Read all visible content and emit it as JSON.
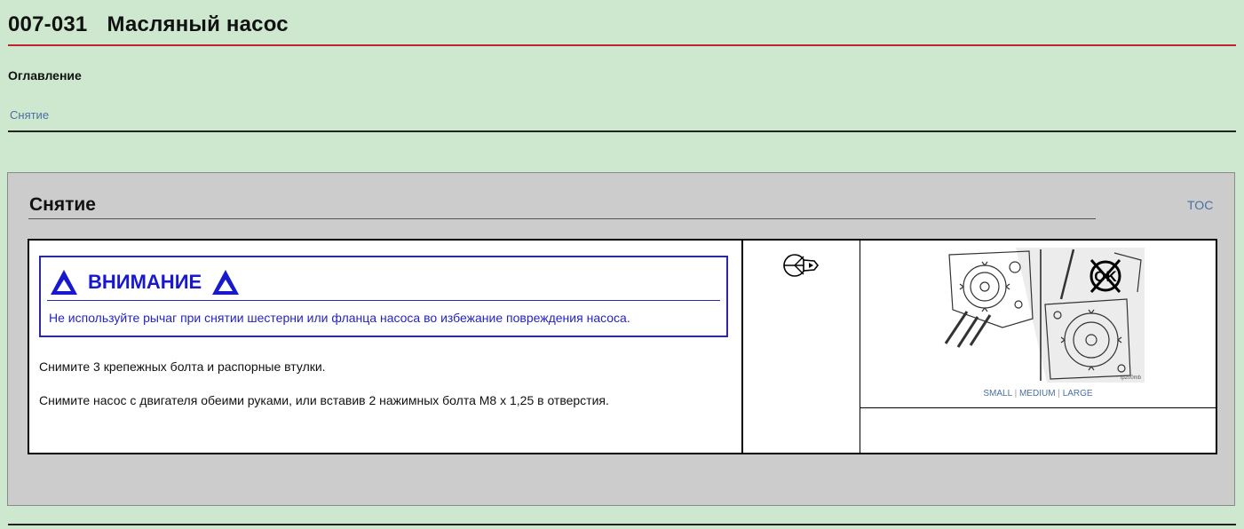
{
  "header": {
    "code": "007-031",
    "title": "Масляный насос"
  },
  "toc": {
    "heading": "Оглавление",
    "items": [
      {
        "label": "Снятие"
      }
    ]
  },
  "section": {
    "title": "Снятие",
    "toc_link": "TOC",
    "warning": {
      "label": "ВНИМАНИЕ",
      "text": "Не используйте рычаг при снятии шестерни или фланца насоса во избежание повреждения насоса."
    },
    "steps": [
      "Снимите 3 крепежных болта и распорные втулки.",
      "Снимите насос с двигателя обеими руками, или вставив 2 нажимных болта M8 x 1,25 в отверстия."
    ],
    "figure": {
      "icon": "ok-crossed-icon",
      "badge": "OK",
      "caption": "ip200mb",
      "sizes": {
        "small": "SMALL",
        "medium": "MEDIUM",
        "large": "LARGE",
        "separator": " | "
      }
    },
    "tool_icon": "socket-wrench-icon"
  },
  "colors": {
    "background": "#cde8cf",
    "title_rule": "#c2222b",
    "link": "#4b6fa3",
    "warning": "#1818cc",
    "section_bg": "#cccccc"
  }
}
